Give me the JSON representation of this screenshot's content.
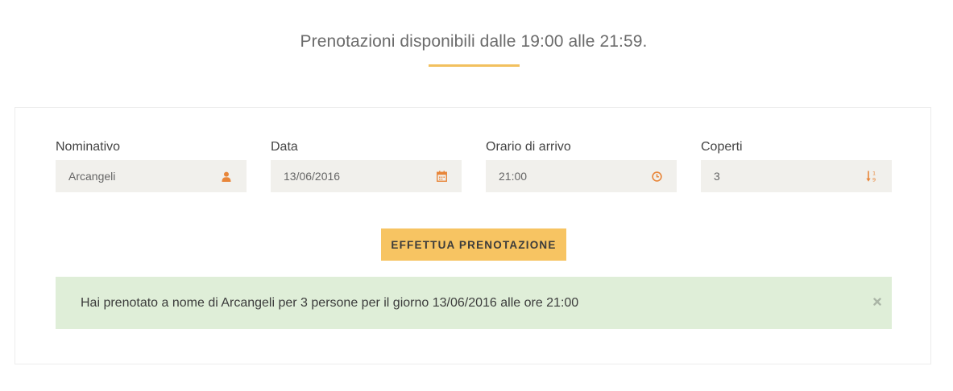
{
  "header": {
    "title": "Prenotazioni disponibili dalle 19:00 alle 21:59."
  },
  "form": {
    "fields": [
      {
        "label": "Nominativo",
        "value": "Arcangeli",
        "icon": "user-icon"
      },
      {
        "label": "Data",
        "value": "13/06/2016",
        "icon": "calendar-icon"
      },
      {
        "label": "Orario di arrivo",
        "value": "21:00",
        "icon": "clock-icon"
      },
      {
        "label": "Coperti",
        "value": "3",
        "icon": "sort-numeric-icon"
      }
    ],
    "submit_label": "EFFETTUA PRENOTAZIONE"
  },
  "alert": {
    "message": "Hai prenotato a nome di Arcangeli per 3 persone per il giorno 13/06/2016 alle ore 21:00",
    "close_icon": "close-icon"
  },
  "colors": {
    "accent": "#f2c05e",
    "button": "#f7c462",
    "icon": "#e8863a",
    "field_bg": "#f1f0ec",
    "alert_bg": "#dfeed8"
  }
}
